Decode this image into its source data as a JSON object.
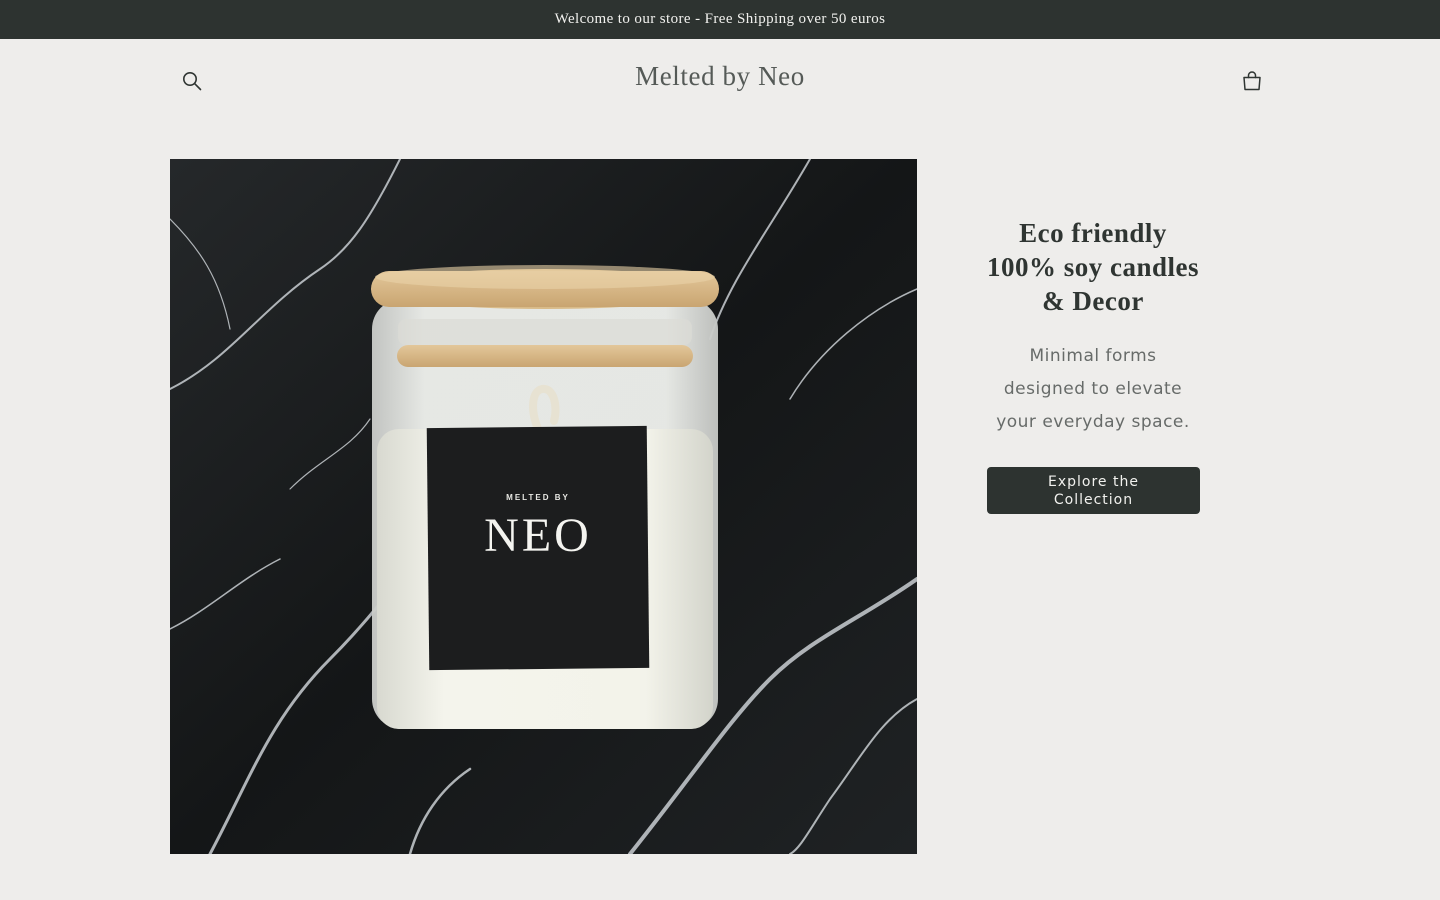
{
  "announcement": {
    "text": "Welcome to our store - Free Shipping over 50 euros"
  },
  "header": {
    "logo_text": "Melted by Neo",
    "search_icon": "search-icon",
    "cart_icon": "cart-icon"
  },
  "hero": {
    "image": {
      "subject": "candle-jar-on-marble",
      "label_small": "MELTED BY",
      "label_large": "NEO"
    },
    "title": "Eco friendly 100% soy candles & Decor",
    "subtitle": "Minimal forms designed to elevate your everyday space.",
    "button_label": "Explore the Collection"
  },
  "colors": {
    "background": "#eeedeb",
    "accent_dark": "#2d3330",
    "text": "#2f3532"
  }
}
